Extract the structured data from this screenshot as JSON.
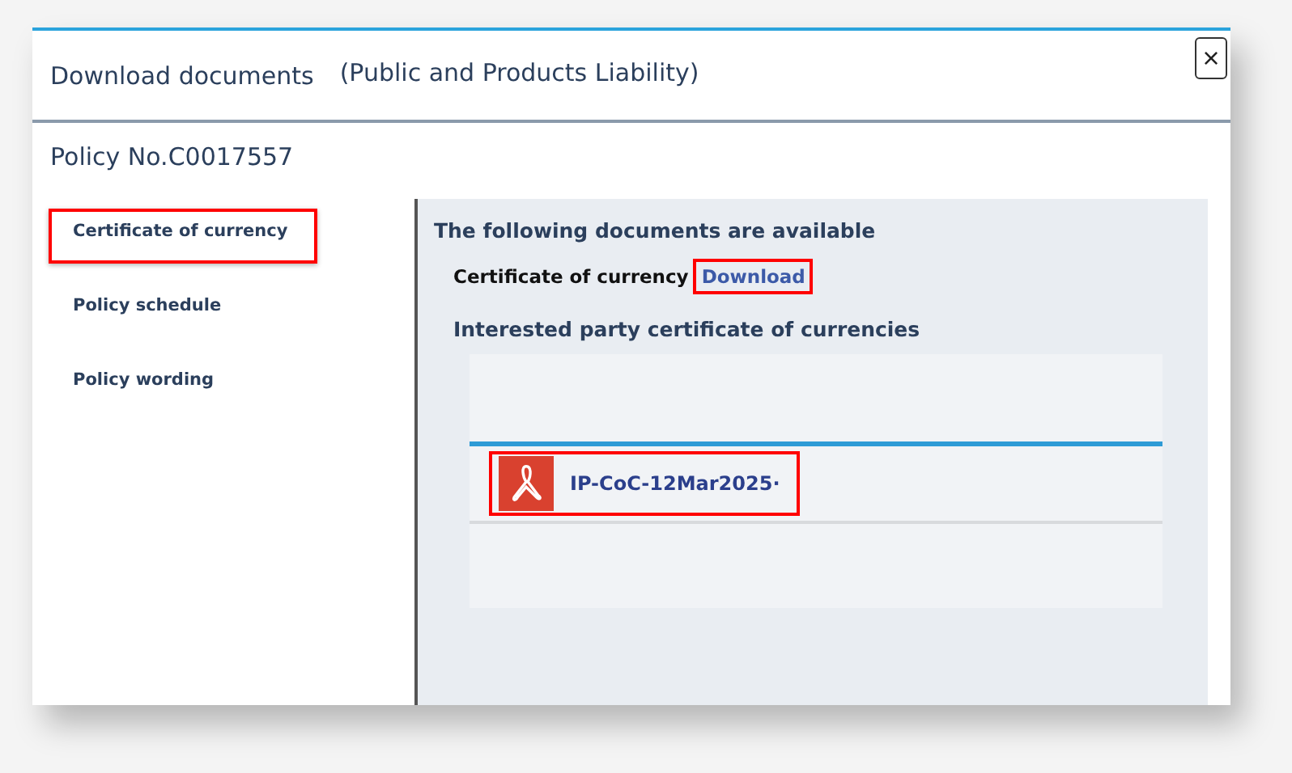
{
  "dialog": {
    "title": "Download documents",
    "subtitle": "(Public and Products Liability)",
    "close_label": "×"
  },
  "policy": "Policy No.C0017557",
  "sidebar": {
    "items": [
      {
        "label": "Certificate of currency",
        "highlighted": true
      },
      {
        "label": "Policy schedule",
        "highlighted": false
      },
      {
        "label": "Policy wording",
        "highlighted": false
      }
    ]
  },
  "content": {
    "heading": "The following documents are available",
    "certificate": {
      "label": "Certificate of currency",
      "link": "Download",
      "highlighted": true
    },
    "interested_party": {
      "heading": "Interested party certificate of currencies",
      "files": [
        {
          "name": "IP-CoC-12Mar2025·",
          "highlighted": true
        }
      ]
    }
  }
}
